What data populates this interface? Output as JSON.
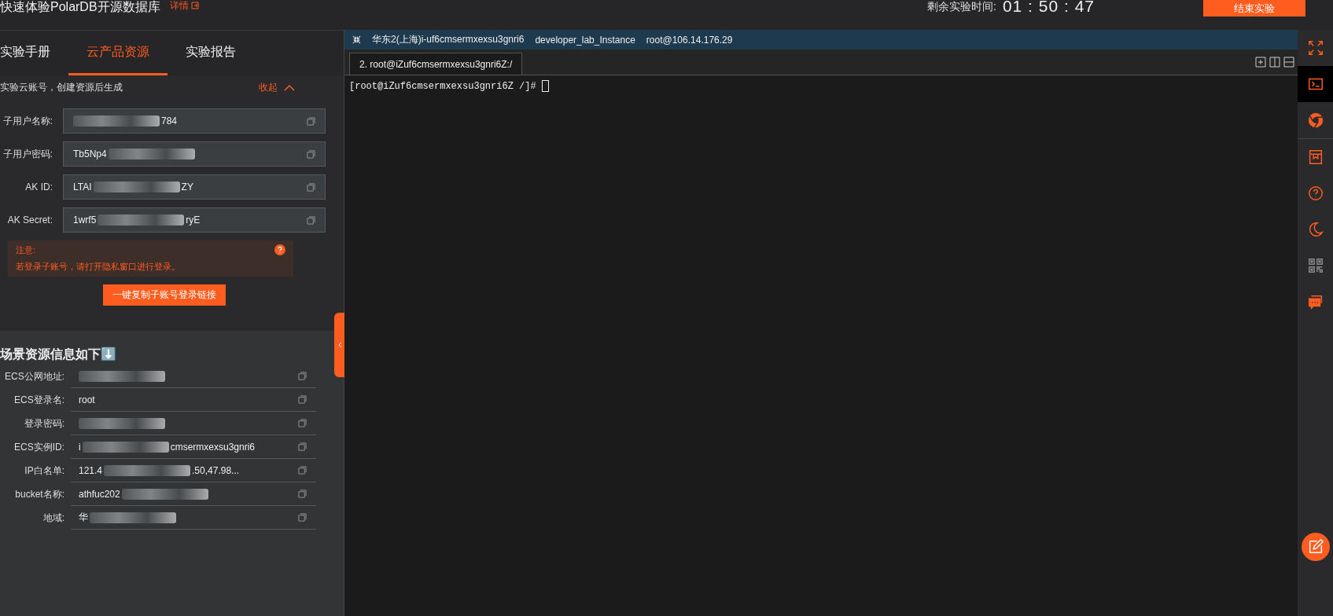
{
  "header": {
    "title": "快速体验PolarDB开源数据库",
    "details_link": "详情",
    "timer_label": "剩余实验时间:",
    "timer": "01 : 50 : 47",
    "end_button": "结束实验"
  },
  "tabs": [
    {
      "label": "实验手册",
      "selected": false
    },
    {
      "label": "云产品资源",
      "selected": true
    },
    {
      "label": "实验报告",
      "selected": false
    }
  ],
  "account": {
    "title": "实验云账号，创建资源后生成",
    "collapse": "收起",
    "fields": [
      {
        "label": "子用户名称:",
        "value_end": "784"
      },
      {
        "label": "子用户密码:",
        "value_start": "Tb5Np4"
      },
      {
        "label": "AK ID:",
        "value_start": "LTAI",
        "value_end": "ZY"
      },
      {
        "label": "AK Secret:",
        "value_start": "1wrf5",
        "value_end": "ryE"
      }
    ],
    "notice": {
      "title": "注意:",
      "text": "若登录子账号，请打开隐私窗口进行登录。"
    },
    "copy_button": "一键复制子账号登录链接"
  },
  "scene": {
    "title": "场景资源信息如下⬇️",
    "rows": [
      {
        "label": "ECS公网地址:"
      },
      {
        "label": "ECS登录名:",
        "value_start": "root",
        "redacted": false
      },
      {
        "label": "登录密码:"
      },
      {
        "label": "ECS实例ID:",
        "value_start": "i",
        "value_end": "cmsermxexsu3gnri6"
      },
      {
        "label": "IP白名单:",
        "value_start": "121.4",
        "value_end": ".50,47.98..."
      },
      {
        "label": "bucket名称:",
        "value_start": "athfuc202"
      },
      {
        "label": "地域:",
        "value_start": "华"
      }
    ]
  },
  "terminal": {
    "header": [
      "华东2(上海)i-uf6cmsermxexsu3gnri6",
      "developer_lab_Instance",
      "root@106.14.176.29"
    ],
    "tabs": [
      {
        "label": "2. root@iZuf6cmsermxexsu3gnri6Z:/",
        "selected": true
      }
    ],
    "lines": [
      "[root@iZuf6cmsermxexsu3gnri6Z /]# "
    ]
  },
  "sidebar": [
    {
      "kind": "fullscreen",
      "selected": false
    },
    {
      "kind": "terminal",
      "selected": true
    },
    {
      "kind": "browser",
      "selected": false
    },
    {
      "kind": "book",
      "selected": false
    },
    {
      "kind": "help",
      "selected": false
    },
    {
      "kind": "theme",
      "selected": false
    },
    {
      "kind": "qrcode",
      "selected": false
    },
    {
      "kind": "chat",
      "selected": false
    }
  ]
}
